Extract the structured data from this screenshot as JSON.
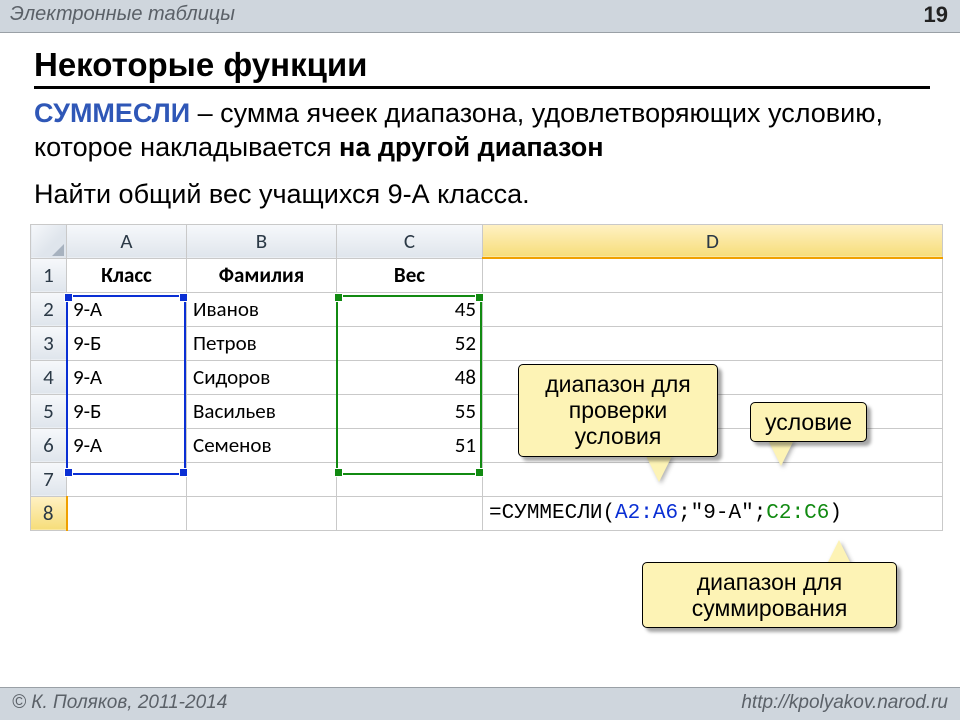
{
  "header": {
    "strip_title": "Электронные таблицы",
    "page_number": "19"
  },
  "footer": {
    "left": "© К. Поляков, 2011-2014",
    "right": "http://kpolyakov.narod.ru"
  },
  "title": "Некоторые функции",
  "paragraph": {
    "func": "СУММЕСЛИ",
    "dash": " – ",
    "part1": "сумма ячеек диапазона, удовлетворяющих условию, которое накладывается ",
    "bold_tail": "на другой диапазон"
  },
  "task": "Найти общий вес учащихся 9-А класса.",
  "sheet": {
    "columns": [
      "A",
      "B",
      "C",
      "D"
    ],
    "row_headers": [
      "1",
      "2",
      "3",
      "4",
      "5",
      "6",
      "7",
      "8"
    ],
    "header_row": {
      "A": "Класс",
      "B": "Фамилия",
      "C": "Вес"
    },
    "rows": [
      {
        "A": "9-А",
        "B": "Иванов",
        "C": "45"
      },
      {
        "A": "9-Б",
        "B": "Петров",
        "C": "52"
      },
      {
        "A": "9-А",
        "B": "Сидоров",
        "C": "48"
      },
      {
        "A": "9-Б",
        "B": "Васильев",
        "C": "55"
      },
      {
        "A": "9-А",
        "B": "Семенов",
        "C": "51"
      }
    ],
    "active_cell": {
      "row": 8,
      "col": "D"
    },
    "formula": {
      "eq": "=",
      "func": "СУММЕСЛИ",
      "open": "(",
      "arg1": "A2:A6",
      "sep1": ";",
      "arg2": "\"9-А\"",
      "sep2": ";",
      "arg3": "C2:C6",
      "close": ")"
    },
    "blue_range": "A2:A6",
    "green_range": "C2:C6"
  },
  "callouts": {
    "range_check": {
      "line1": "диапазон для",
      "line2": "проверки",
      "line3": "условия"
    },
    "criterion": "условие",
    "sum_range": {
      "line1": "диапазон для",
      "line2": "суммирования"
    }
  }
}
